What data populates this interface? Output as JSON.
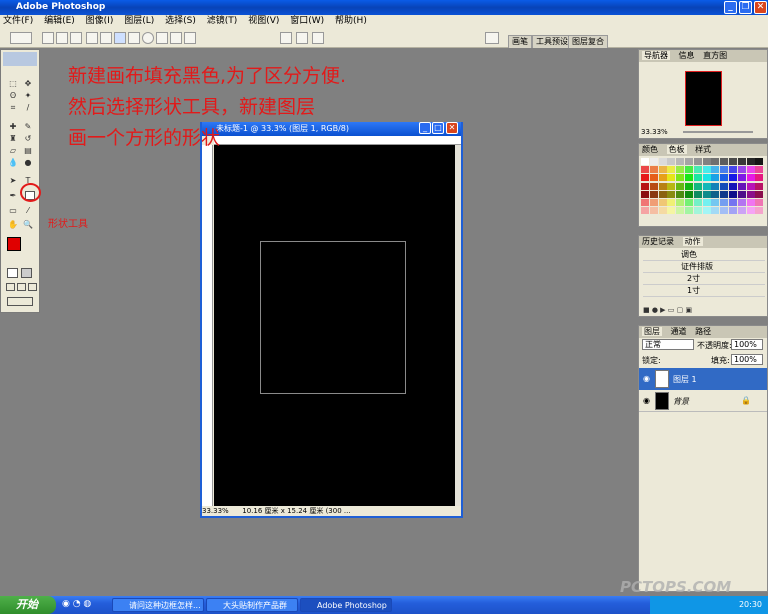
{
  "app": {
    "title": "Adobe Photoshop"
  },
  "menu": [
    "文件(F)",
    "编辑(E)",
    "图像(I)",
    "图层(L)",
    "选择(S)",
    "滤镜(T)",
    "视图(V)",
    "窗口(W)",
    "帮助(H)"
  ],
  "well_tabs": [
    "画笔",
    "工具预设",
    "图层复合"
  ],
  "instructions": [
    "新建画布填充黑色,为了区分方便.",
    "然后选择形状工具，新建图层",
    "画一个方形的形状"
  ],
  "annotation": {
    "label": "形状工具",
    "color": "#e21a1a"
  },
  "document": {
    "title": "未标题-1 @ 33.3% (图层 1, RGB/8)",
    "zoom": "33.33%",
    "doc_info": "10.16 厘米 x 15.24 厘米 (300 ..."
  },
  "panels": {
    "navigator": {
      "tabs": [
        "导航器",
        "信息",
        "直方图"
      ],
      "zoom": "33.33%"
    },
    "swatches": {
      "tabs": [
        "颜色",
        "色板",
        "样式"
      ]
    },
    "history": {
      "tabs": [
        "历史记录",
        "动作"
      ],
      "items": [
        {
          "label": "调色",
          "indent": 0
        },
        {
          "label": "证件排版",
          "indent": 0
        },
        {
          "label": "2寸",
          "indent": 1
        },
        {
          "label": "1寸",
          "indent": 1
        }
      ]
    },
    "layers": {
      "tabs": [
        "图层",
        "通道",
        "路径"
      ],
      "blend_mode": "正常",
      "opacity_label": "不透明度:",
      "opacity": "100%",
      "lock_label": "锁定:",
      "fill_label": "填充:",
      "fill": "100%",
      "layers": [
        {
          "name": "图层 1",
          "selected": true
        },
        {
          "name": "背景",
          "selected": false
        }
      ]
    }
  },
  "taskbar": {
    "start": "开始",
    "tasks": [
      "请问这种边框怎样...",
      "大头贴制作产品群",
      "Adobe Photoshop"
    ],
    "time": "20:30",
    "watermark": "PCTOPS.COM"
  },
  "colors": {
    "accent": "#e21a1a",
    "canvas": "#000000",
    "title_blue": "#0a52d6"
  }
}
